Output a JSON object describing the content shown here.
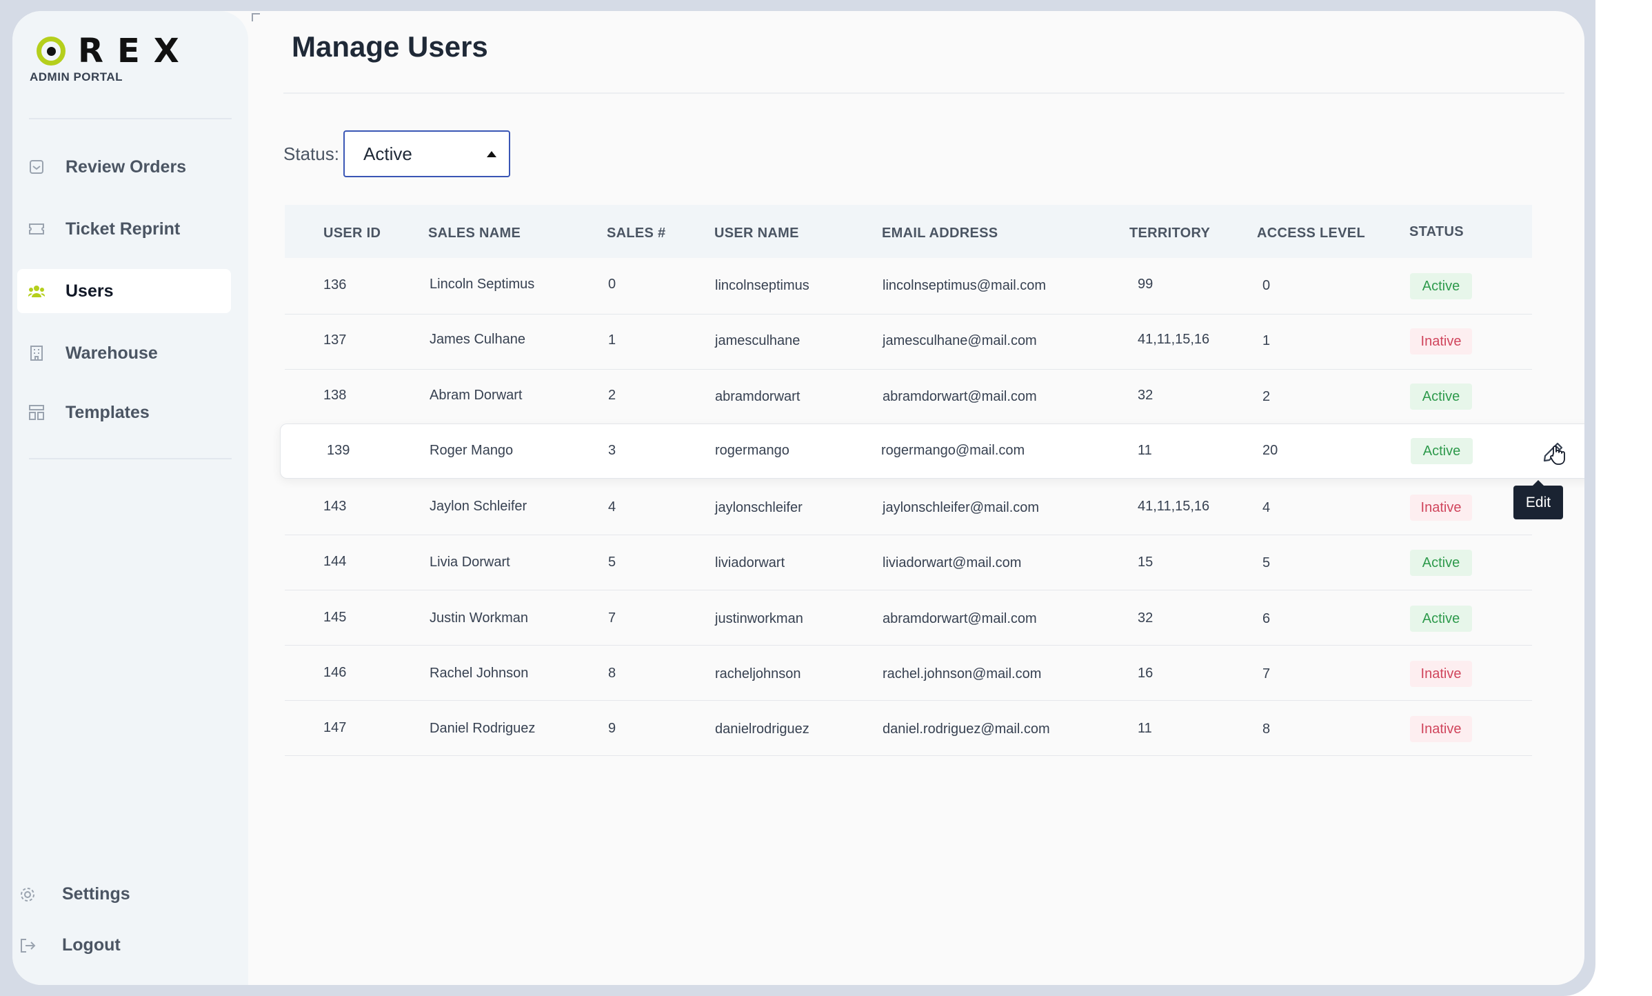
{
  "brand": {
    "logo_text": "REX",
    "portal_label": "ADMIN PORTAL",
    "accent_color": "#b5cf1c"
  },
  "sidebar": {
    "items": [
      {
        "label": "Review Orders",
        "icon": "inbox-icon"
      },
      {
        "label": "Ticket Reprint",
        "icon": "ticket-icon"
      },
      {
        "label": "Users",
        "icon": "users-icon",
        "active": true
      },
      {
        "label": "Warehouse",
        "icon": "building-icon"
      },
      {
        "label": "Templates",
        "icon": "layout-icon"
      }
    ],
    "bottom": [
      {
        "label": "Settings",
        "icon": "gear-icon"
      },
      {
        "label": "Logout",
        "icon": "logout-icon"
      }
    ]
  },
  "page": {
    "title": "Manage Users"
  },
  "filter": {
    "label": "Status:",
    "value": "Active"
  },
  "table": {
    "columns": [
      "USER ID",
      "SALES NAME",
      "SALES #",
      "USER NAME",
      "EMAIL ADDRESS",
      "TERRITORY",
      "ACCESS LEVEL",
      "STATUS"
    ],
    "rows": [
      {
        "id": "136",
        "sales_name": "Lincoln Septimus",
        "sales_no": "0",
        "user_name": "lincolnseptimus",
        "email": "lincolnseptimus@mail.com",
        "territory": "99",
        "access": "0",
        "status": "Active"
      },
      {
        "id": "137",
        "sales_name": "James Culhane",
        "sales_no": "1",
        "user_name": "jamesculhane",
        "email": "jamesculhane@mail.com",
        "territory": "41,11,15,16",
        "access": "1",
        "status": "Inative"
      },
      {
        "id": "138",
        "sales_name": "Abram Dorwart",
        "sales_no": "2",
        "user_name": "abramdorwart",
        "email": "abramdorwart@mail.com",
        "territory": "32",
        "access": "2",
        "status": "Active"
      },
      {
        "id": "139",
        "sales_name": "Roger Mango",
        "sales_no": "3",
        "user_name": "rogermango",
        "email": "rogermango@mail.com",
        "territory": "11",
        "access": "20",
        "status": "Active"
      },
      {
        "id": "143",
        "sales_name": "Jaylon Schleifer",
        "sales_no": "4",
        "user_name": "jaylonschleifer",
        "email": "jaylonschleifer@mail.com",
        "territory": "41,11,15,16",
        "access": "4",
        "status": "Inative"
      },
      {
        "id": "144",
        "sales_name": "Livia Dorwart",
        "sales_no": "5",
        "user_name": "liviadorwart",
        "email": "liviadorwart@mail.com",
        "territory": "15",
        "access": "5",
        "status": "Active"
      },
      {
        "id": "145",
        "sales_name": "Justin Workman",
        "sales_no": "7",
        "user_name": "justinworkman",
        "email": "abramdorwart@mail.com",
        "territory": "32",
        "access": "6",
        "status": "Active"
      },
      {
        "id": "146",
        "sales_name": "Rachel Johnson",
        "sales_no": "8",
        "user_name": "racheljohnson",
        "email": "rachel.johnson@mail.com",
        "territory": "16",
        "access": "7",
        "status": "Inative"
      },
      {
        "id": "147",
        "sales_name": "Daniel Rodriguez",
        "sales_no": "9",
        "user_name": "danielrodriguez",
        "email": "daniel.rodriguez@mail.com",
        "territory": "11",
        "access": "8",
        "status": "Inative"
      }
    ]
  },
  "row_action": {
    "icon": "pencil-icon",
    "tooltip": "Edit"
  },
  "status_colors": {
    "active": "#2e9a4c",
    "inactive": "#d0455c"
  }
}
